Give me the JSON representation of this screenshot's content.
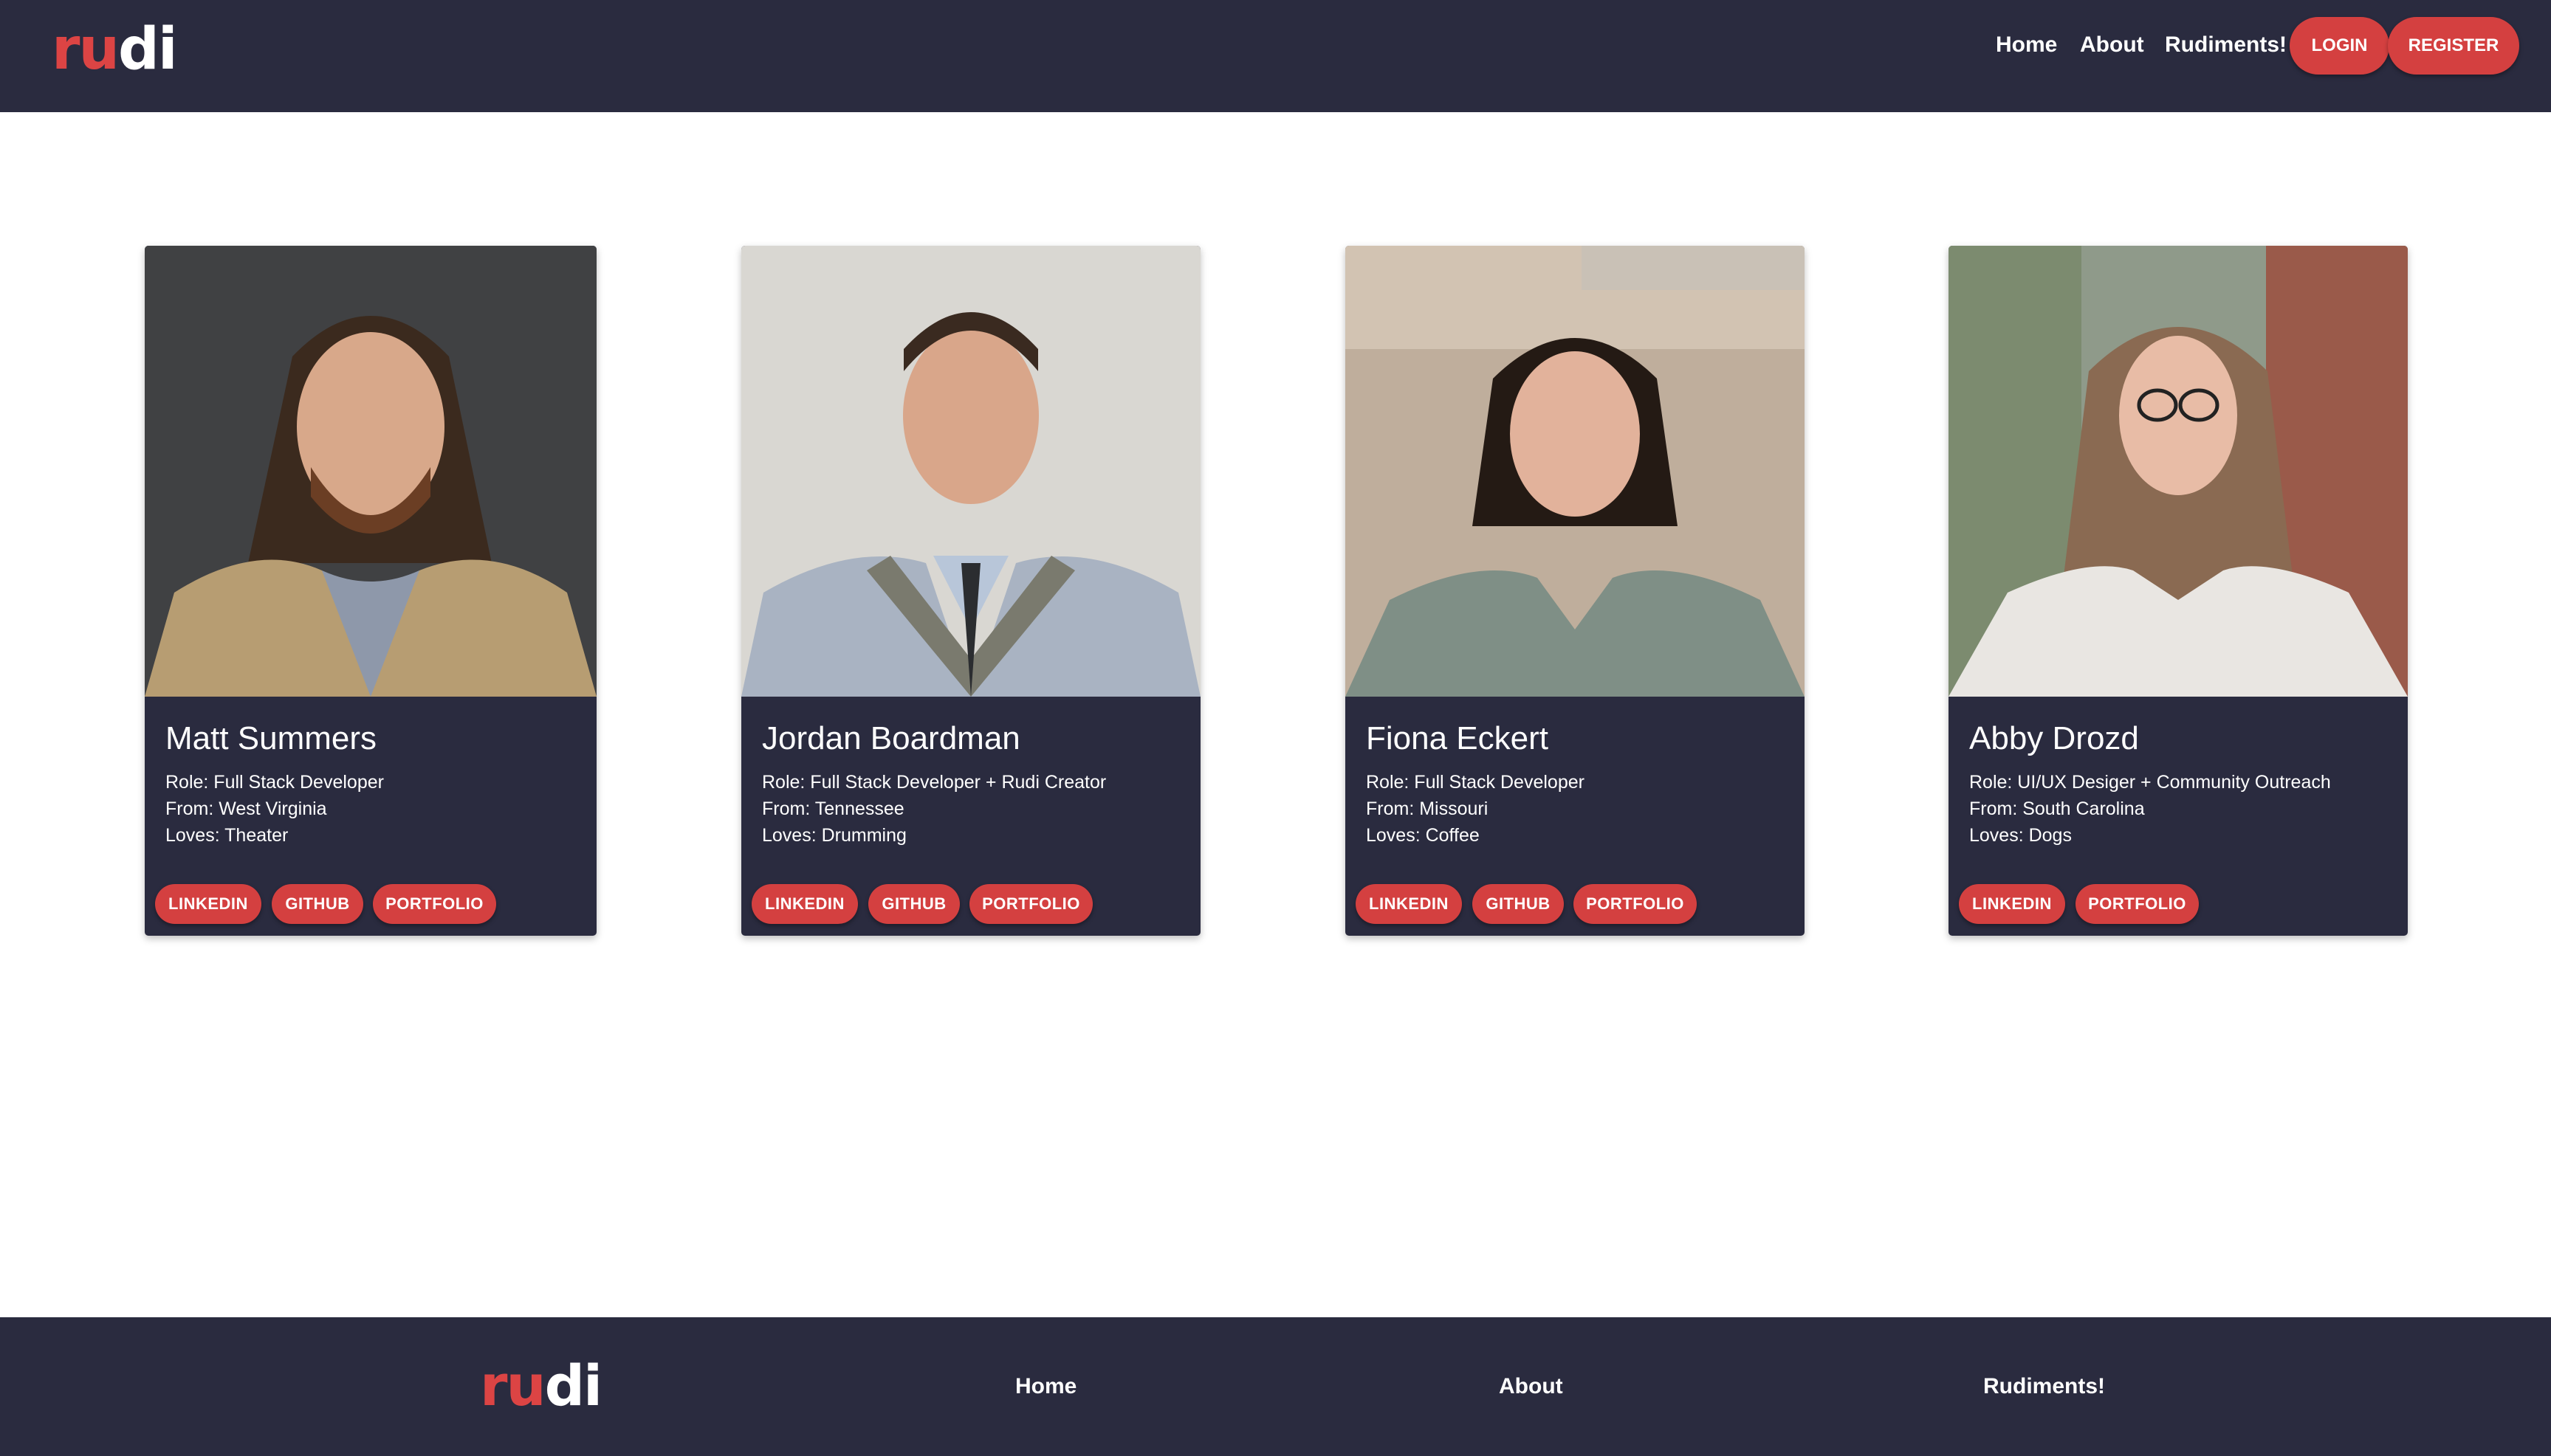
{
  "header": {
    "logo": {
      "part1": "ru",
      "part2": "di"
    },
    "nav": {
      "home": "Home",
      "about": "About",
      "rudiments": "Rudiments!"
    },
    "login": "LOGIN",
    "register": "REGISTER"
  },
  "team": [
    {
      "name": "Matt Summers",
      "role": "Role: Full Stack Developer",
      "from": "From: West Virginia",
      "loves": "Loves: Theater",
      "links": [
        "LINKEDIN",
        "GITHUB",
        "PORTFOLIO"
      ]
    },
    {
      "name": "Jordan Boardman",
      "role": "Role: Full Stack Developer + Rudi Creator",
      "from": "From: Tennessee",
      "loves": "Loves: Drumming",
      "links": [
        "LINKEDIN",
        "GITHUB",
        "PORTFOLIO"
      ]
    },
    {
      "name": "Fiona Eckert",
      "role": "Role: Full Stack Developer",
      "from": "From: Missouri",
      "loves": "Loves: Coffee",
      "links": [
        "LINKEDIN",
        "GITHUB",
        "PORTFOLIO"
      ]
    },
    {
      "name": "Abby Drozd",
      "role": "Role: UI/UX Desiger + Community Outreach",
      "from": "From: South Carolina",
      "loves": "Loves: Dogs",
      "links": [
        "LINKEDIN",
        "PORTFOLIO"
      ]
    }
  ],
  "footer": {
    "logo": {
      "part1": "ru",
      "part2": "di"
    },
    "nav": {
      "home": "Home",
      "about": "About",
      "rudiments": "Rudiments!"
    }
  },
  "colors": {
    "navy": "#2a2b3f",
    "accent_red": "#d44040",
    "text_white": "#ffffff"
  }
}
